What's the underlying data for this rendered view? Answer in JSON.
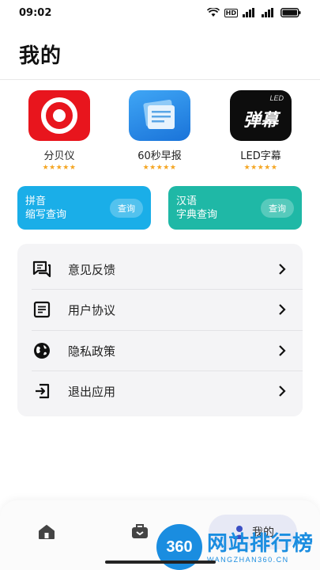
{
  "status_bar": {
    "time": "09:02",
    "badge": "HD"
  },
  "page_title": "我的",
  "apps": [
    {
      "name": "分贝仪",
      "stars": "★★★★★",
      "icon": "decibel-icon"
    },
    {
      "name": "60秒早报",
      "stars": "★★★★★",
      "icon": "news-icon"
    },
    {
      "name": "LED字幕",
      "stars": "★★★★★",
      "icon": "led-icon",
      "icon_text": "弹幕",
      "icon_small": "LED"
    }
  ],
  "cards": [
    {
      "line1": "拼音",
      "line2": "缩写查询",
      "button": "查询",
      "color": "#1aaee8"
    },
    {
      "line1": "汉语",
      "line2": "字典查询",
      "button": "查询",
      "color": "#1fb8a6"
    }
  ],
  "menu": [
    {
      "label": "意见反馈",
      "icon": "feedback-icon"
    },
    {
      "label": "用户协议",
      "icon": "document-icon"
    },
    {
      "label": "隐私政策",
      "icon": "globe-icon"
    },
    {
      "label": "退出应用",
      "icon": "exit-icon"
    }
  ],
  "tabbar": {
    "active_label": "我的"
  },
  "watermark": {
    "logo": "360",
    "title": "网站排行榜",
    "subtitle": "WANGZHAN360.CN"
  }
}
